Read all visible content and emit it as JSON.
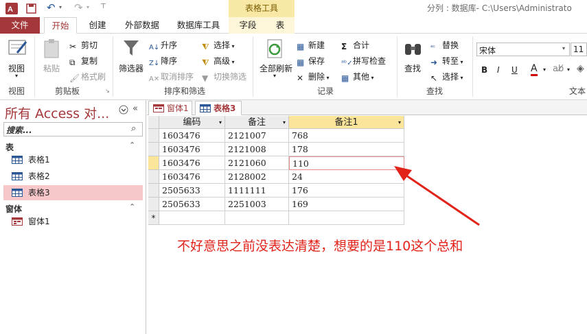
{
  "window": {
    "title_right": "分列 : 数据库- C:\\Users\\Administrato",
    "context_tab": "表格工具"
  },
  "tabs": [
    "文件",
    "开始",
    "创建",
    "外部数据",
    "数据库工具",
    "字段",
    "表"
  ],
  "ribbon": {
    "view": {
      "button": "视图",
      "group": "视图"
    },
    "clipboard": {
      "paste": "粘贴",
      "cut": "剪切",
      "copy": "复制",
      "format_painter": "格式刷",
      "group": "剪贴板"
    },
    "sort_filter": {
      "filter": "筛选器",
      "ascending": "升序",
      "descending": "降序",
      "remove_sort": "取消排序",
      "selection": "选择",
      "advanced": "高级",
      "toggle_filter": "切换筛选",
      "group": "排序和筛选"
    },
    "records": {
      "refresh_all": "全部刷新",
      "new": "新建",
      "save": "保存",
      "delete": "删除",
      "totals": "合计",
      "spelling": "拼写检查",
      "more": "其他",
      "group": "记录"
    },
    "find": {
      "find": "查找",
      "replace": "替换",
      "goto": "转至",
      "select": "选择",
      "group": "查找"
    },
    "text_format": {
      "font": "宋体",
      "size": "11",
      "bold": "B",
      "italic": "I",
      "underline": "U",
      "group": "文本"
    }
  },
  "nav": {
    "title": "所有 Access 对...",
    "search_placeholder": "搜索...",
    "sections": [
      {
        "label": "表",
        "items": [
          "表格1",
          "表格2",
          "表格3"
        ]
      },
      {
        "label": "窗体",
        "items": [
          "窗体1"
        ]
      }
    ],
    "selected": "表格3"
  },
  "doc_tabs": [
    "窗体1",
    "表格3"
  ],
  "table": {
    "columns": [
      "编码",
      "备注",
      "备注1"
    ],
    "rows": [
      [
        "1603476",
        "2121007",
        "768"
      ],
      [
        "1603476",
        "2121008",
        "178"
      ],
      [
        "1603476",
        "2121060",
        "110"
      ],
      [
        "1603476",
        "2128002",
        "24"
      ],
      [
        "2505633",
        "1111111",
        "176"
      ],
      [
        "2505633",
        "2251003",
        "169"
      ]
    ],
    "new_row_marker": "*"
  },
  "annotation": "不好意思之前没表达清楚，想要的是110这个总和",
  "colors": {
    "access_red": "#a4373a",
    "annotation_red": "#e2231a",
    "selected_nav": "#f8c7c9",
    "context_tab": "#f8e8a6"
  }
}
